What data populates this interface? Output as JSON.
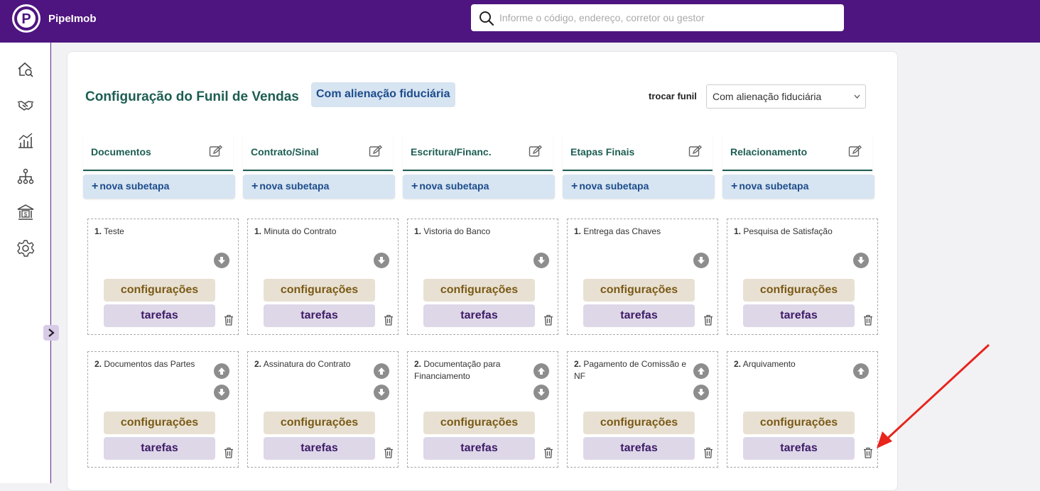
{
  "app": {
    "name": "PipeImob",
    "logo_letter": "P"
  },
  "search": {
    "placeholder": "Informe o código, endereço, corretor ou gestor"
  },
  "sidebar": {
    "icons": [
      "home-search-icon",
      "handshake-icon",
      "chart-icon",
      "hierarchy-icon",
      "bank-icon",
      "gear-icon"
    ],
    "toggle_icon": "chevron-right-icon"
  },
  "header": {
    "title": "Configuração do Funil de Vendas",
    "funnel_badge": "Com alienação fiduciária",
    "switch_label": "trocar funil",
    "switch_value": "Com alienação fiduciária"
  },
  "new_substep_label": "nova subetapa",
  "buttons": {
    "config": "configurações",
    "tasks": "tarefas"
  },
  "columns": [
    {
      "name": "Documentos",
      "steps": [
        {
          "num": "1.",
          "title": "Teste"
        },
        {
          "num": "2.",
          "title": "Documentos das Partes"
        }
      ]
    },
    {
      "name": "Contrato/Sinal",
      "steps": [
        {
          "num": "1.",
          "title": "Minuta do Contrato"
        },
        {
          "num": "2.",
          "title": "Assinatura do Contrato"
        }
      ]
    },
    {
      "name": "Escritura/Financ.",
      "steps": [
        {
          "num": "1.",
          "title": "Vistoria do Banco"
        },
        {
          "num": "2.",
          "title": "Documentação para Financiamento"
        }
      ]
    },
    {
      "name": "Etapas Finais",
      "steps": [
        {
          "num": "1.",
          "title": "Entrega das Chaves"
        },
        {
          "num": "2.",
          "title": "Pagamento de Comissão e NF"
        }
      ]
    },
    {
      "name": "Relacionamento",
      "steps": [
        {
          "num": "1.",
          "title": "Pesquisa de Satisfação"
        },
        {
          "num": "2.",
          "title": "Arquivamento"
        }
      ]
    }
  ],
  "colors": {
    "topbar": "#4e1580",
    "heading": "#1d5e52",
    "badge_bg": "#d7e4f1",
    "config_bg": "#e8e1d3",
    "tasks_bg": "#ddd7e8",
    "annotation_arrow": "#e8241d"
  }
}
